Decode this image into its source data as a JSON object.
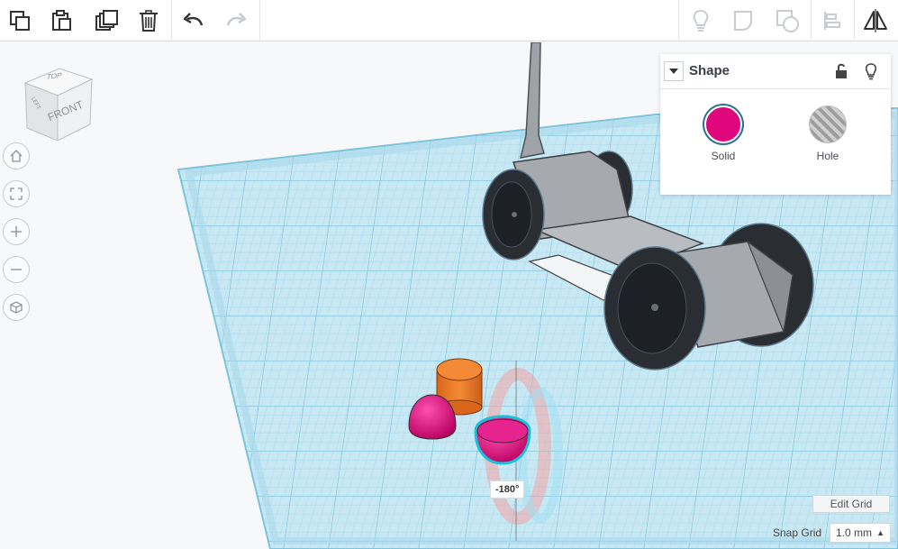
{
  "toolbar": {
    "left_tools": [
      {
        "name": "copy-icon",
        "tooltip": "Copy"
      },
      {
        "name": "paste-icon",
        "tooltip": "Paste"
      },
      {
        "name": "duplicate-icon",
        "tooltip": "Duplicate"
      },
      {
        "name": "delete-icon",
        "tooltip": "Delete"
      },
      {
        "name": "undo-icon",
        "tooltip": "Undo"
      },
      {
        "name": "redo-icon",
        "tooltip": "Redo"
      }
    ],
    "right_tools": [
      {
        "name": "lightbulb-icon",
        "tooltip": "Show all"
      },
      {
        "name": "group-icon",
        "tooltip": "Group"
      },
      {
        "name": "ungroup-icon",
        "tooltip": "Ungroup"
      },
      {
        "name": "align-icon",
        "tooltip": "Align"
      },
      {
        "name": "mirror-icon",
        "tooltip": "Mirror"
      }
    ]
  },
  "view_cube": {
    "top_label": "TOP",
    "front_label": "FRONT",
    "left_label": "LEFT"
  },
  "nav_buttons": [
    {
      "name": "home-view-icon"
    },
    {
      "name": "fit-view-icon"
    },
    {
      "name": "zoom-in-icon"
    },
    {
      "name": "zoom-out-icon"
    },
    {
      "name": "perspective-icon"
    }
  ],
  "shape_panel": {
    "title": "Shape",
    "options": [
      {
        "label": "Solid",
        "color": "#e0077d",
        "selected": true
      },
      {
        "label": "Hole",
        "color": "#b0b0b0",
        "selected": false
      }
    ]
  },
  "rotation_readout": "-180°",
  "grid_controls": {
    "edit_grid_label": "Edit Grid",
    "snap_grid_label": "Snap Grid",
    "snap_grid_value": "1.0 mm"
  },
  "colors": {
    "workplane": "#c8e8f4",
    "grid_line": "#8cc8de",
    "solid": "#e0077d",
    "orange": "#f07f2a",
    "car_gray": "#a6aaae",
    "wheel": "#2a2d31"
  }
}
